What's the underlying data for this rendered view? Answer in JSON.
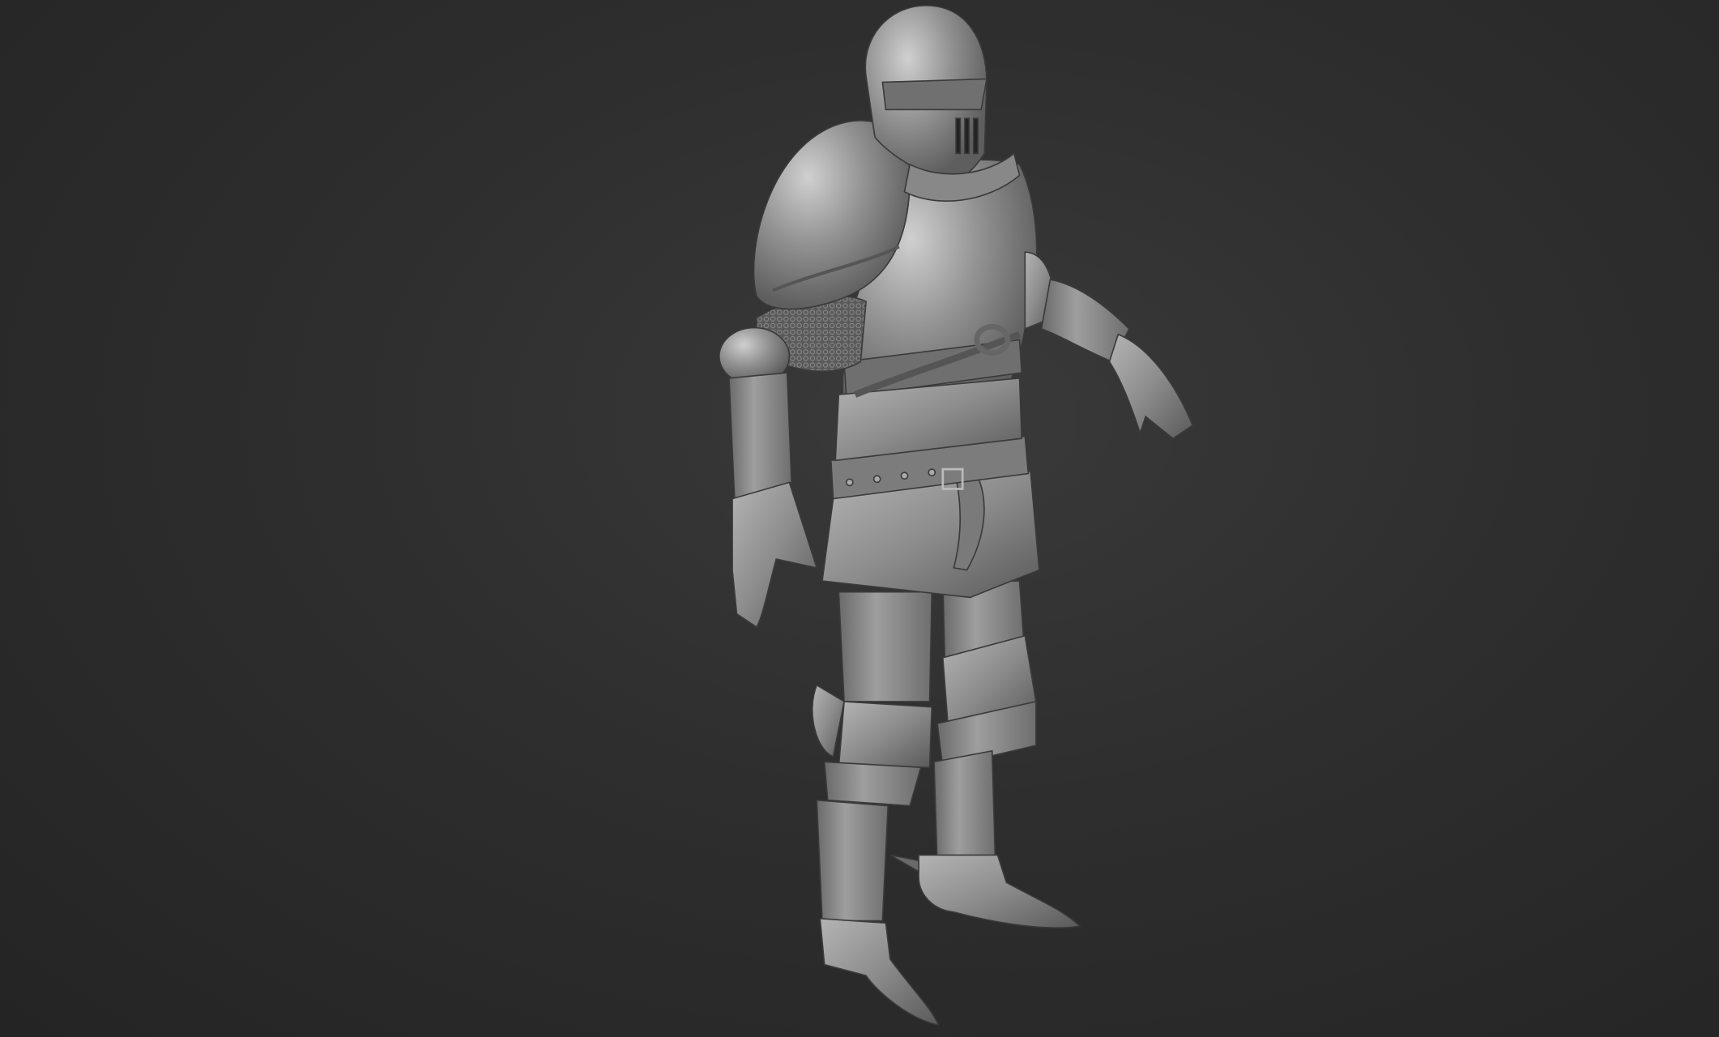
{
  "scene": {
    "subject": "armored-knight-model",
    "colors": {
      "background": "#2e2e2e",
      "armor_light": "#a8a8a8",
      "armor_mid": "#8a8a8a",
      "armor_dark": "#5e5e5e",
      "outline": "#3c3c3c"
    }
  }
}
